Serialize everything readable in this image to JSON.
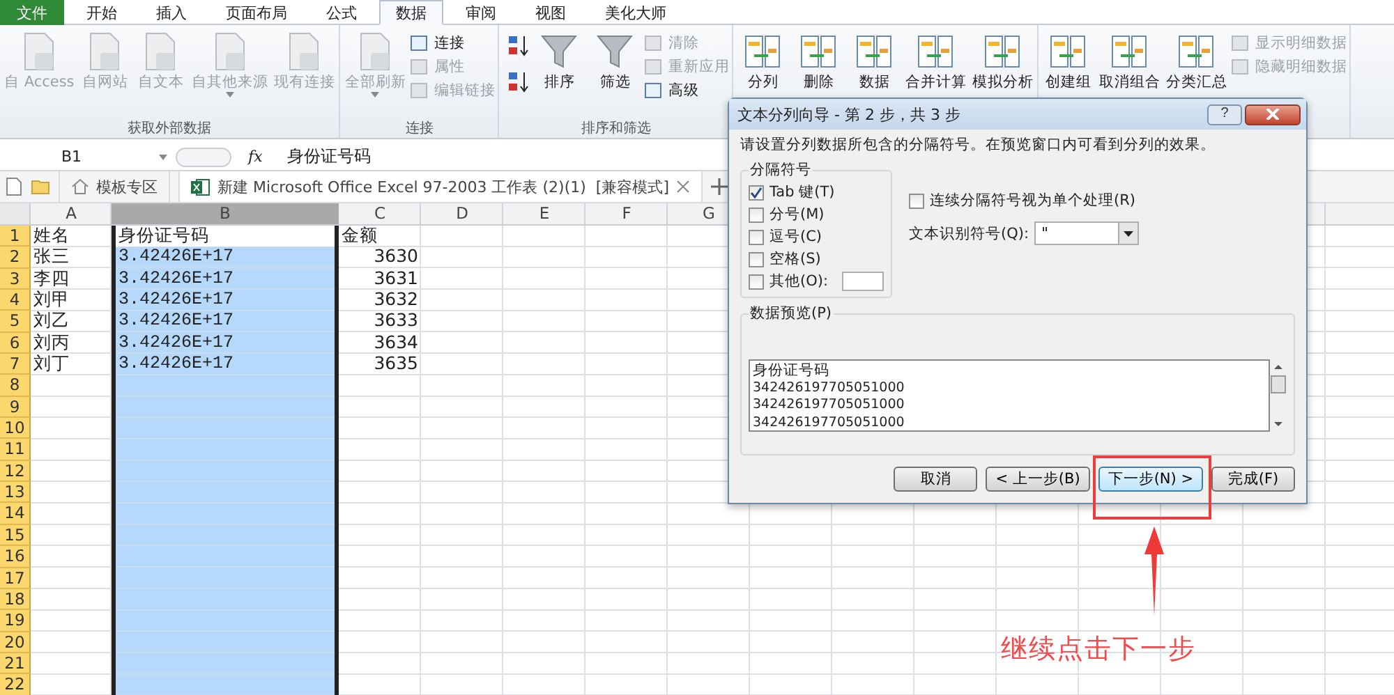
{
  "menu_tabs": [
    {
      "label": "文件",
      "selected": false,
      "kind": "file"
    },
    {
      "label": "开始",
      "selected": false,
      "kind": "tab"
    },
    {
      "label": "插入",
      "selected": false,
      "kind": "tab"
    },
    {
      "label": "页面布局",
      "selected": false,
      "kind": "tab"
    },
    {
      "label": "公式",
      "selected": false,
      "kind": "tab"
    },
    {
      "label": "数据",
      "selected": true,
      "kind": "tab"
    },
    {
      "label": "审阅",
      "selected": false,
      "kind": "tab"
    },
    {
      "label": "视图",
      "selected": false,
      "kind": "tab"
    },
    {
      "label": "美化大师",
      "selected": false,
      "kind": "tab"
    }
  ],
  "ribbon": {
    "groups": [
      {
        "label": "获取外部数据",
        "items": [
          {
            "kind": "large",
            "label": "自 Access",
            "disabled": true,
            "dropdown": false
          },
          {
            "kind": "large",
            "label": "自网站",
            "disabled": true,
            "dropdown": false
          },
          {
            "kind": "large",
            "label": "自文本",
            "disabled": true,
            "dropdown": false
          },
          {
            "kind": "large",
            "label": "自其他来源",
            "disabled": true,
            "dropdown": true
          },
          {
            "kind": "large",
            "label": "现有连接",
            "disabled": true,
            "dropdown": false
          }
        ]
      },
      {
        "label": "连接",
        "items": [
          {
            "kind": "large",
            "label": "全部刷新",
            "disabled": true,
            "dropdown": true
          },
          {
            "kind": "stack",
            "items": [
              {
                "label": "连接",
                "disabled": false
              },
              {
                "label": "属性",
                "disabled": true
              },
              {
                "label": "编辑链接",
                "disabled": true
              }
            ]
          }
        ]
      },
      {
        "label": "排序和筛选",
        "items": [
          {
            "kind": "sort"
          },
          {
            "kind": "large",
            "label": "排序",
            "disabled": false,
            "dropdown": false
          },
          {
            "kind": "large",
            "label": "筛选",
            "disabled": false,
            "dropdown": false
          },
          {
            "kind": "stack",
            "items": [
              {
                "label": "清除",
                "disabled": true
              },
              {
                "label": "重新应用",
                "disabled": true
              },
              {
                "label": "高级",
                "disabled": false
              }
            ]
          }
        ]
      },
      {
        "items": [
          {
            "kind": "large",
            "label": "分列",
            "disabled": false,
            "dropdown": false
          },
          {
            "kind": "large",
            "label": "删除",
            "disabled": false,
            "dropdown": false
          },
          {
            "kind": "large",
            "label": "数据",
            "disabled": false,
            "dropdown": false
          },
          {
            "kind": "large",
            "label": "合并计算",
            "disabled": false,
            "dropdown": false
          },
          {
            "kind": "large",
            "label": "模拟分析",
            "disabled": false,
            "dropdown": false
          }
        ]
      },
      {
        "items": [
          {
            "kind": "large",
            "label": "创建组",
            "disabled": false,
            "dropdown": false
          },
          {
            "kind": "large",
            "label": "取消组合",
            "disabled": false,
            "dropdown": false
          },
          {
            "kind": "large",
            "label": "分类汇总",
            "disabled": false,
            "dropdown": false
          },
          {
            "kind": "stack",
            "items": [
              {
                "label": "显示明细数据",
                "disabled": true
              },
              {
                "label": "隐藏明细数据",
                "disabled": true
              }
            ]
          }
        ]
      }
    ]
  },
  "formula_bar": {
    "name_box": "B1",
    "fx": "fx",
    "value": "身份证号码"
  },
  "doc_tabs": [
    {
      "kind": "home",
      "label": "模板专区",
      "selected": false
    },
    {
      "kind": "workbook",
      "label": "新建 Microsoft Office Excel 97-2003 工作表 (2)(1)  [兼容模式]",
      "selected": true
    }
  ],
  "sheet": {
    "columns": [
      {
        "label": "A",
        "selected": false
      },
      {
        "label": "B",
        "selected": true
      },
      {
        "label": "C",
        "selected": false
      },
      {
        "label": "D",
        "selected": false
      },
      {
        "label": "E",
        "selected": false
      },
      {
        "label": "F",
        "selected": false
      },
      {
        "label": "G",
        "selected": false
      }
    ],
    "rows": [
      {
        "number": "1",
        "cells": [
          "姓名",
          "身份证号码",
          "金额"
        ]
      },
      {
        "number": "2",
        "cells": [
          "张三",
          "3.42426E+17",
          "3630"
        ]
      },
      {
        "number": "3",
        "cells": [
          "李四",
          "3.42426E+17",
          "3631"
        ]
      },
      {
        "number": "4",
        "cells": [
          "刘甲",
          "3.42426E+17",
          "3632"
        ]
      },
      {
        "number": "5",
        "cells": [
          "刘乙",
          "3.42426E+17",
          "3633"
        ]
      },
      {
        "number": "6",
        "cells": [
          "刘丙",
          "3.42426E+17",
          "3634"
        ]
      },
      {
        "number": "7",
        "cells": [
          "刘丁",
          "3.42426E+17",
          "3635"
        ]
      },
      {
        "number": "8",
        "cells": []
      },
      {
        "number": "9",
        "cells": []
      },
      {
        "number": "10",
        "cells": []
      },
      {
        "number": "11",
        "cells": []
      },
      {
        "number": "12",
        "cells": []
      },
      {
        "number": "13",
        "cells": []
      },
      {
        "number": "14",
        "cells": []
      },
      {
        "number": "15",
        "cells": []
      },
      {
        "number": "16",
        "cells": []
      },
      {
        "number": "17",
        "cells": []
      },
      {
        "number": "18",
        "cells": []
      },
      {
        "number": "19",
        "cells": []
      },
      {
        "number": "20",
        "cells": []
      },
      {
        "number": "21",
        "cells": []
      },
      {
        "number": "22",
        "cells": []
      }
    ]
  },
  "dialog": {
    "title": "文本分列向导 - 第 2 步，共 3 步",
    "help": "?",
    "instruction": "请设置分列数据所包含的分隔符号。在预览窗口内可看到分列的效果。",
    "delimiters": {
      "label": "分隔符号",
      "items": [
        {
          "label": "Tab 键(T)",
          "checked": true,
          "kind": "check"
        },
        {
          "label": "分号(M)",
          "checked": false,
          "kind": "check"
        },
        {
          "label": "逗号(C)",
          "checked": false,
          "kind": "check"
        },
        {
          "label": "空格(S)",
          "checked": false,
          "kind": "check"
        },
        {
          "label": "其他(O):",
          "checked": false,
          "kind": "other"
        }
      ]
    },
    "consecutive": {
      "label": "连续分隔符号视为单个处理(R)",
      "checked": false
    },
    "qualifier": {
      "label": "文本识别符号(Q):",
      "value": "\""
    },
    "preview": {
      "label": "数据预览(P)",
      "lines": [
        "身份证号码",
        "342426197705051000",
        "342426197705051000",
        "342426197705051000"
      ]
    },
    "buttons": [
      {
        "label": "取消",
        "focused": false
      },
      {
        "label": "< 上一步(B)",
        "focused": false
      },
      {
        "label": "下一步(N) >",
        "focused": true
      },
      {
        "label": "完成(F)",
        "focused": false
      }
    ]
  },
  "annotation": {
    "text": "继续点击下一步"
  }
}
